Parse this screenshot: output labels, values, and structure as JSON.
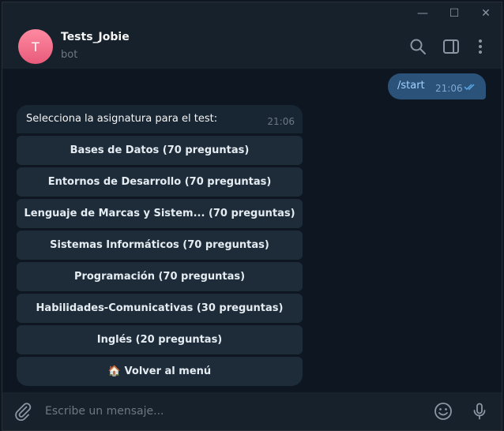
{
  "window": {
    "minimize_glyph": "—",
    "maximize_glyph": "☐",
    "close_glyph": "✕"
  },
  "header": {
    "avatar_letter": "T",
    "name": "Tests_Jobie",
    "status": "bot",
    "icons": [
      "search-icon",
      "sidebar-toggle-icon",
      "more-options-icon"
    ]
  },
  "messages": {
    "outgoing": {
      "text": "/start",
      "time": "21:06"
    },
    "incoming": {
      "text": "Selecciona la asignatura para el test:",
      "time": "21:06"
    }
  },
  "keyboard": {
    "buttons": [
      "Bases de Datos (70 preguntas)",
      "Entornos de Desarrollo (70 preguntas)",
      "Lenguaje de Marcas y Sistem... (70 preguntas)",
      "Sistemas Informáticos (70 preguntas)",
      "Programación (70 preguntas)",
      "Habilidades-Comunicativas (30 preguntas)",
      "Inglés (20 preguntas)",
      "🏠 Volver al menú"
    ]
  },
  "composer": {
    "placeholder": "Escribe un mensaje...",
    "icons": [
      "paperclip-icon",
      "emoji-icon",
      "microphone-icon"
    ]
  },
  "colors": {
    "background": "#0e1621",
    "panel": "#17212b",
    "outgoing_bubble": "#2b5278",
    "incoming_bubble": "#182533",
    "keyboard_button": "#1e2c3a",
    "accent": "#5aa9e6"
  }
}
